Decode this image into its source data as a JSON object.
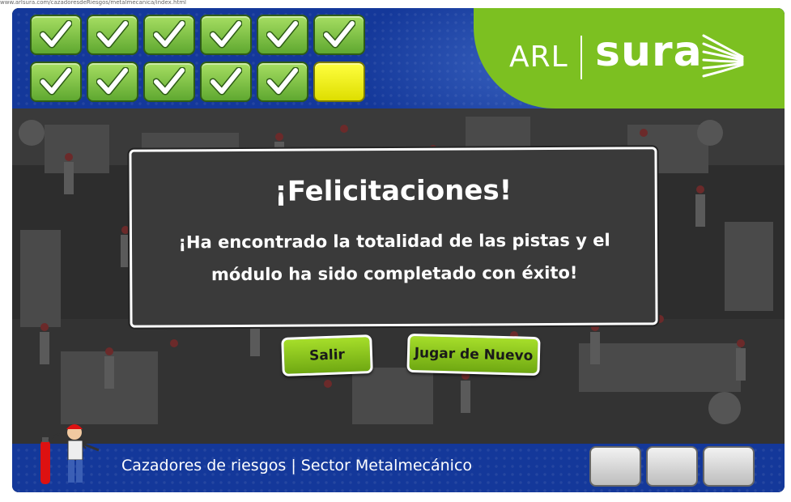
{
  "url_fragment": "www.arlsura.com/cazadoresdeRiesgos/metalmecanica/index.html",
  "progress": {
    "tiles": [
      {
        "state": "done"
      },
      {
        "state": "done"
      },
      {
        "state": "done"
      },
      {
        "state": "done"
      },
      {
        "state": "done"
      },
      {
        "state": "done"
      },
      {
        "state": "done"
      },
      {
        "state": "done"
      },
      {
        "state": "done"
      },
      {
        "state": "done"
      },
      {
        "state": "done"
      },
      {
        "state": "pending"
      }
    ],
    "done_color": "#7cc021",
    "pending_color": "#ffff00",
    "icon": "checkmark-icon"
  },
  "brand": {
    "arl": "ARL",
    "sura": "sura"
  },
  "dialog": {
    "title": "¡Felicitaciones!",
    "message": "¡Ha encontrado la totalidad de las pistas y el módulo ha sido completado con éxito!"
  },
  "buttons": {
    "exit": "Salir",
    "replay": "Jugar de Nuevo"
  },
  "footer": {
    "caption": "Cazadores de riesgos | Sector Metalmecánico"
  },
  "colors": {
    "header_blue": "#14389a",
    "brand_green": "#7cc021",
    "dialog_bg": "#3a3a3a"
  }
}
